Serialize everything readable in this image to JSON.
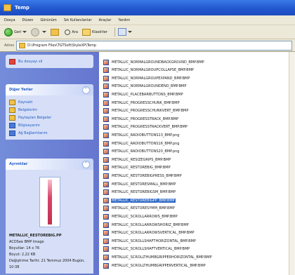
{
  "window": {
    "title": "Temp"
  },
  "menu": [
    "Dosya",
    "Düzen",
    "Görünüm",
    "Sık Kullanılanlar",
    "Araçlar",
    "Yardım"
  ],
  "toolbar": {
    "back": "Geri",
    "search": "Ara",
    "folders": "Klasörler"
  },
  "address": {
    "label": "Adres",
    "path": "D:\\Program Files\\TGTSoft\\StyleXP\\Temp"
  },
  "left": {
    "top_item": "Bu dosyayı sil",
    "other_places": {
      "title": "Diğer Yerler",
      "items": [
        {
          "label": "Kaynakt",
          "icon": "folder-icon"
        },
        {
          "label": "Belgelerim",
          "icon": "folder-icon"
        },
        {
          "label": "Paylaşılan Belgeler",
          "icon": "folder-icon"
        },
        {
          "label": "Bilgisayarım",
          "icon": "computer-icon"
        },
        {
          "label": "Ağ Bağlantılarım",
          "icon": "network-icon"
        }
      ]
    },
    "details": {
      "title": "Ayrıntılar",
      "thumb_label": "METALLIC",
      "name": "METALLIC_RESTOREBIG.PP",
      "type": "ACDSee BMP Image",
      "dimensions": "Boyutlar: 14 x 76",
      "size": "Boyut: 2,22 KB",
      "modified": "Değiştirme Tarihi: 21 Temmuz 2004 Bugün, 10:38"
    }
  },
  "files": [
    "METALLIC_NORMALGROUNDBACKGROUND_BMP.BMP",
    "METALLIC_NORMALGROUPCOLLAPSE_BMP.BMP",
    "METALLIC_NORMALGROUPEXPAND_BMP.BMP",
    "METALLIC_NORMALGROUNDEND_BMP.BMP",
    "METALLIC_PLACEBARBUTTONS_BMP.BMP",
    "METALLIC_PROGRESSCHUNK_BMP.BMP",
    "METALLIC_PROGRESSCHUNKVERT_BMP.BMP",
    "METALLIC_PROGRESSTRACK_BMP.BMP",
    "METALLIC_PROGRESSTRACKVERT_BMP.BMP",
    "METALLIC_RADIOBUTTONS13_BMP.png",
    "METALLIC_RADIOBUTTONS16_BMP.png",
    "METALLIC_RADIOBUTTONS20_BMP.png",
    "METALLIC_RESIZEGRIPS_BMP.BMP",
    "METALLIC_RESTOREBIG_BMP.BMP",
    "METALLIC_RESTOREBIGPRESS_BMP.BMP",
    "METALLIC_RESTORESMALL_BMP.BMP",
    "METALLIC_RESTOREBIGSM_BMP.BMP",
    "METALLIC_RESTOREBIGPP_BMP.BMP",
    "METALLIC_RESTORESYMM_BMP.BMP",
    "METALLIC_SCROLLARROWS_BMP.BMP",
    "METALLIC_SCROLLARROWSHORIZ_BMP.BMP",
    "METALLIC_SCROLLARROWSVERTICAL_BMP.BMP",
    "METALLIC_SCROLLSHAFTHORIZONTAL_BMP.BMP",
    "METALLIC_SCROLLSHAFTVERTICAL_BMP.BMP",
    "METALLIC_SCROLLTHUMBGRIPPERHORIZONTAL_BMP.BMP",
    "METALLIC_SCROLLTHUMBGRIPPERVERTICAL_BMP.BMP"
  ],
  "selected_index": 17
}
